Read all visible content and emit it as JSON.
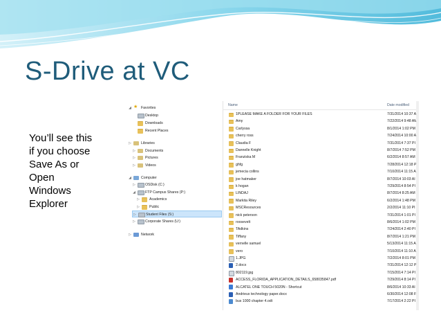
{
  "slide": {
    "title": "S-Drive at VC",
    "caption_lines": [
      "You’ll see this",
      "if you choose",
      "Save As or",
      "Open",
      "Windows",
      "Explorer"
    ]
  },
  "explorer": {
    "nav": [
      {
        "label": "Favorites",
        "icon": "star-icon",
        "indent": 0,
        "arrow": "◢"
      },
      {
        "label": "Desktop",
        "icon": "desktop-icon",
        "indent": 1,
        "arrow": ""
      },
      {
        "label": "Downloads",
        "icon": "downloads-folder-icon",
        "indent": 1,
        "arrow": ""
      },
      {
        "label": "Recent Places",
        "icon": "recent-places-icon",
        "indent": 1,
        "arrow": ""
      },
      {
        "label": "",
        "icon": "",
        "indent": 0,
        "arrow": ""
      },
      {
        "label": "Libraries",
        "icon": "libraries-icon",
        "indent": 0,
        "arrow": "▷"
      },
      {
        "label": "Documents",
        "icon": "documents-icon",
        "indent": 1,
        "arrow": "▷"
      },
      {
        "label": "Pictures",
        "icon": "pictures-icon",
        "indent": 1,
        "arrow": "▷"
      },
      {
        "label": "Videos",
        "icon": "videos-icon",
        "indent": 1,
        "arrow": "▷"
      },
      {
        "label": "",
        "icon": "",
        "indent": 0,
        "arrow": ""
      },
      {
        "label": "Computer",
        "icon": "computer-icon",
        "indent": 0,
        "arrow": "◢"
      },
      {
        "label": "OSDisk (C:)",
        "icon": "drive-icon",
        "indent": 1,
        "arrow": "▷"
      },
      {
        "label": "FTP Campus Shares (P:)",
        "icon": "network-drive-icon",
        "indent": 1,
        "arrow": "◢"
      },
      {
        "label": "Academics",
        "icon": "folder-icon",
        "indent": 2,
        "arrow": "▷"
      },
      {
        "label": "Public",
        "icon": "folder-icon",
        "indent": 2,
        "arrow": "▷"
      },
      {
        "label": "Student Files (S:)",
        "icon": "network-drive-icon",
        "indent": 1,
        "arrow": "▷",
        "selected": true
      },
      {
        "label": "Corporate Shares (U:)",
        "icon": "network-drive-icon",
        "indent": 1,
        "arrow": "▷"
      },
      {
        "label": "",
        "icon": "",
        "indent": 0,
        "arrow": ""
      },
      {
        "label": "Network",
        "icon": "network-icon",
        "indent": 0,
        "arrow": "▷"
      }
    ],
    "columns": {
      "name": "Name",
      "date": "Date modified"
    },
    "files": [
      {
        "name": "1PLEASE MAKE A FOLDER FOR YOUR FILES",
        "date": "7/31/2014 10:37 A",
        "type": "folder"
      },
      {
        "name": "Amy",
        "date": "7/22/2014 9:48 AM",
        "type": "folder"
      },
      {
        "name": "Carlyssa",
        "date": "8/1/2014 1:02 PM",
        "type": "folder"
      },
      {
        "name": "cherry ross",
        "date": "7/24/2014 10:00 A",
        "type": "folder"
      },
      {
        "name": "Claudia F",
        "date": "7/31/2014 7:37 PI",
        "type": "folder"
      },
      {
        "name": "Dannelle Knight",
        "date": "8/7/2014 7:52 PM",
        "type": "folder"
      },
      {
        "name": "Franziska M",
        "date": "6/2/2014 8:57 AM",
        "type": "folder"
      },
      {
        "name": "ghfg",
        "date": "7/28/2014 12:18 P",
        "type": "folder"
      },
      {
        "name": "jemecia collins",
        "date": "7/10/2014 11:15 A",
        "type": "folder"
      },
      {
        "name": "joe hatmaker",
        "date": "8/7/2014 10:03 AI",
        "type": "folder"
      },
      {
        "name": "k hogan",
        "date": "7/29/2014 8:54 PI",
        "type": "folder"
      },
      {
        "name": "LINDAJ",
        "date": "8/7/2014 8:25 AM",
        "type": "folder"
      },
      {
        "name": "Markita Riley",
        "date": "6/2/2014 1:48 PM",
        "type": "folder"
      },
      {
        "name": "MSCResources",
        "date": "2/2/2014 11:10 PI",
        "type": "folder"
      },
      {
        "name": "nick peterson",
        "date": "7/31/2014 1:01 PI",
        "type": "folder"
      },
      {
        "name": "roosevelt",
        "date": "8/6/2014 1:02 PM",
        "type": "folder"
      },
      {
        "name": "TAdkins",
        "date": "7/24/2014 2:40 PI",
        "type": "folder"
      },
      {
        "name": "Tiffany",
        "date": "8/7/2014 1:21 PM",
        "type": "folder"
      },
      {
        "name": "vernelle samuel",
        "date": "5/13/2014 11:15 A",
        "type": "folder"
      },
      {
        "name": "vero",
        "date": "7/10/2014 11:10 A",
        "type": "folder"
      },
      {
        "name": "1.JPG",
        "date": "7/2/2014 8:01 PM",
        "type": "img"
      },
      {
        "name": "2.docx",
        "date": "7/31/2014 12:12 P",
        "type": "doc"
      },
      {
        "name": "802119.jpg",
        "date": "7/15/2014 7:14 PI",
        "type": "img"
      },
      {
        "name": "ACCESS_FLORIDA_APPLICATION_DETAILS_658035847.pdf",
        "date": "7/29/2014 8:14 PI",
        "type": "pdf"
      },
      {
        "name": "ALCATEL ONE TOUCH 5020N - Shortcut",
        "date": "8/6/2014 10:33 AI",
        "type": "lnk"
      },
      {
        "name": "Andrieux technology paper.docx",
        "date": "6/30/2014 12:08 F",
        "type": "doc"
      },
      {
        "name": "bus 1000 chapter 4.odt",
        "date": "7/17/2014 2:22 PI",
        "type": "odt"
      }
    ]
  }
}
